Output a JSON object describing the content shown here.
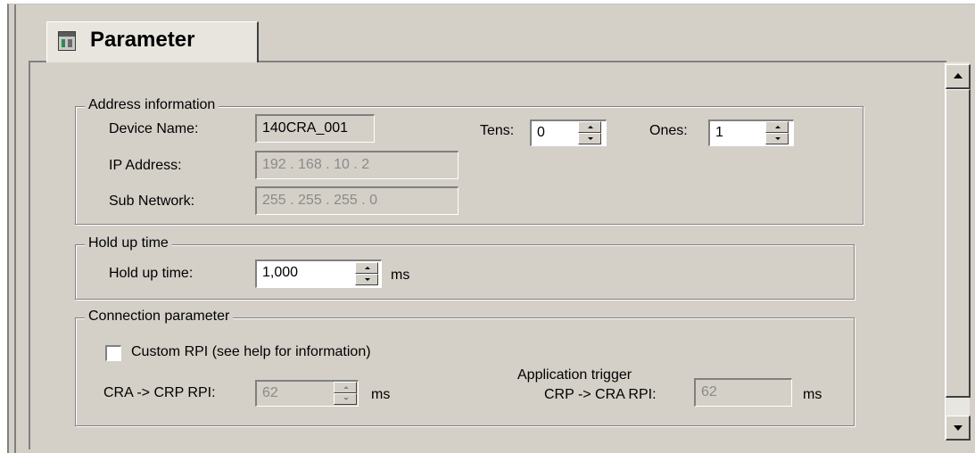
{
  "tab": {
    "label": "Parameter",
    "icon": "module-parameter-icon"
  },
  "address_information": {
    "title": "Address information",
    "device_name": {
      "label": "Device Name:",
      "value": "140CRA_001"
    },
    "tens": {
      "label": "Tens:",
      "value": "0"
    },
    "ones": {
      "label": "Ones:",
      "value": "1"
    },
    "ip_address": {
      "label": "IP Address:",
      "value": "192 . 168 .  10 .   2"
    },
    "sub_network": {
      "label": "Sub Network:",
      "value": "255 . 255 . 255 . 0"
    }
  },
  "hold_up_time": {
    "title": "Hold up time",
    "label": "Hold up time:",
    "value": "1,000",
    "unit": "ms"
  },
  "connection_parameter": {
    "title": "Connection parameter",
    "custom_rpi": {
      "label": "Custom RPI (see help for information)",
      "checked": false
    },
    "cra_crp_rpi": {
      "label": "CRA -> CRP RPI:",
      "value": "62",
      "unit": "ms"
    },
    "app_trigger": {
      "label_line1": "Application trigger",
      "label_line2": "CRP -> CRA RPI:",
      "value": "62",
      "unit": "ms"
    }
  },
  "colors": {
    "panel_bg": "#d4d0c8",
    "field_bg": "#ffffff",
    "disabled_text": "#8a8a8a",
    "border_dark": "#808080"
  }
}
